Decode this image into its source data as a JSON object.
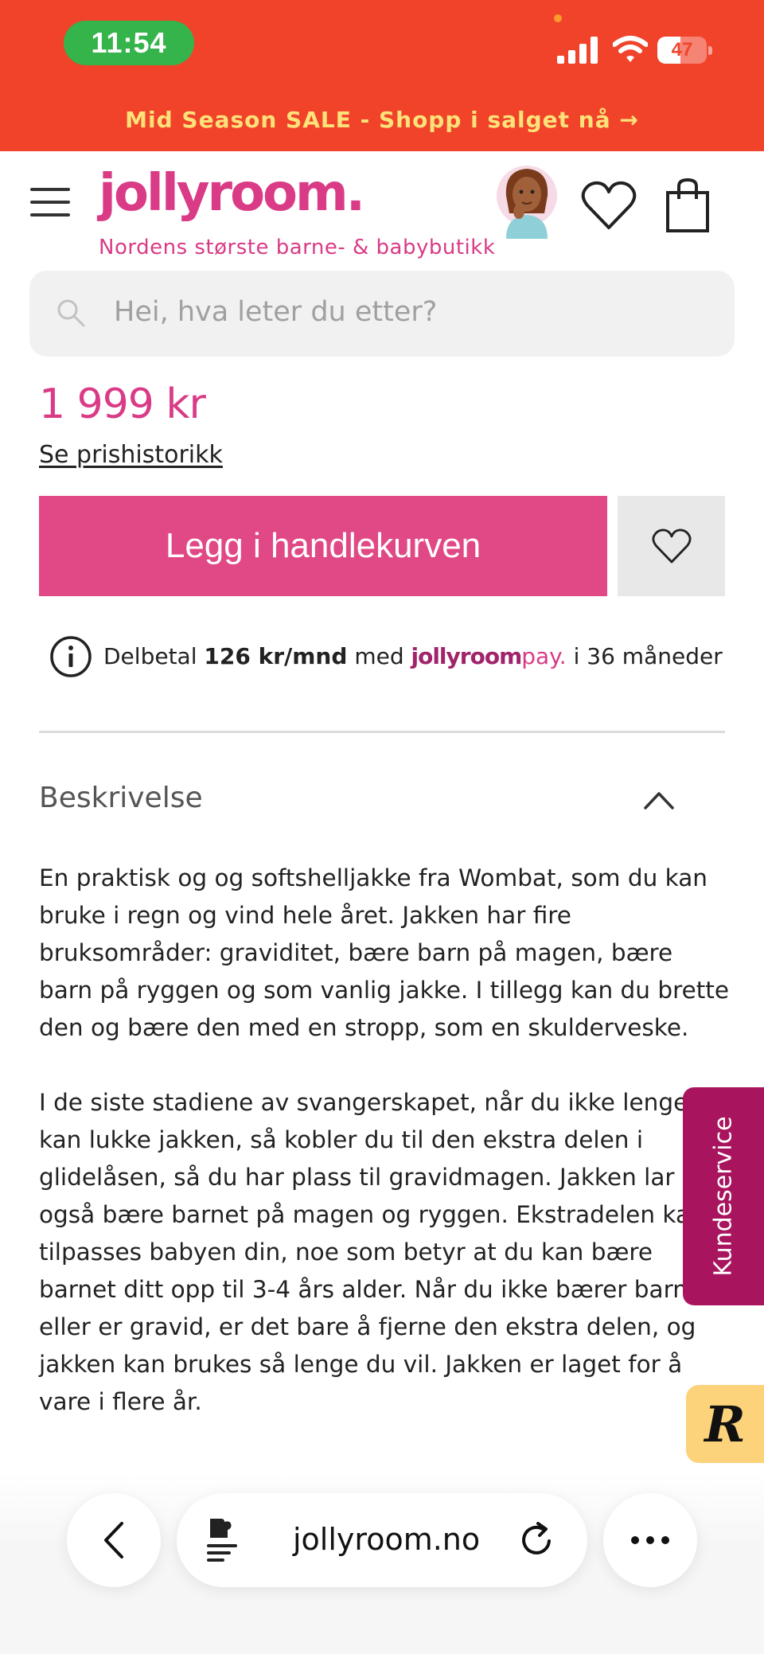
{
  "status_bar": {
    "time": "11:54",
    "battery_level": "47",
    "battery_fraction": 0.47
  },
  "promo": {
    "text": "Mid Season SALE - Shopp i salget nå →"
  },
  "header": {
    "logo": "jollyroom.",
    "tagline": "Nordens største barne- & babybutikk",
    "icons": [
      "menu-icon",
      "avatar",
      "heart-icon",
      "shopping-bag-icon"
    ]
  },
  "search": {
    "placeholder": "Hei, hva leter du etter?"
  },
  "product": {
    "price": "1 999 kr",
    "price_history_link": "Se prishistorikk",
    "add_to_cart": "Legg i handlekurven"
  },
  "installment": {
    "prefix": "Delbetal",
    "amount": "126 kr/mnd",
    "middle": "med",
    "brand_main": "jollyroom",
    "brand_suffix": "pay.",
    "suffix": "i 36 måneder"
  },
  "description": {
    "title": "Beskrivelse",
    "paragraphs": [
      "En praktisk og og softshelljakke fra Wombat, som du kan bruke i regn og vind hele året. Jakken har fire bruksområder: graviditet, bære barn på magen, bære barn på ryggen og som vanlig jakke. I tillegg kan du brette den og bære den med en stropp, som en skulderveske.",
      "I de siste stadiene av svangerskapet, når du ikke lenger kan lukke jakken, så kobler du til den ekstra delen i glidelåsen, så du har plass til gravidmagen. Jakken lar deg også bære barnet på magen og ryggen. Ekstradelen kan tilpasses babyen din, noe som betyr at du kan bære barnet ditt opp til 3-4 års alder. Når du ikke bærer barnet eller er gravid, er det bare å fjerne den ekstra delen, og jakken kan brukes så lenge du vil. Jakken er laget for å vare i flere år."
    ]
  },
  "floating": {
    "customer_service": "Kundeservice",
    "badge_letter": "R"
  },
  "browser": {
    "url": "jollyroom.no"
  },
  "colors": {
    "brand_pink": "#d93b86",
    "banner": "#f0432a",
    "cart_button": "#e04886",
    "customer_service": "#a8155e"
  }
}
